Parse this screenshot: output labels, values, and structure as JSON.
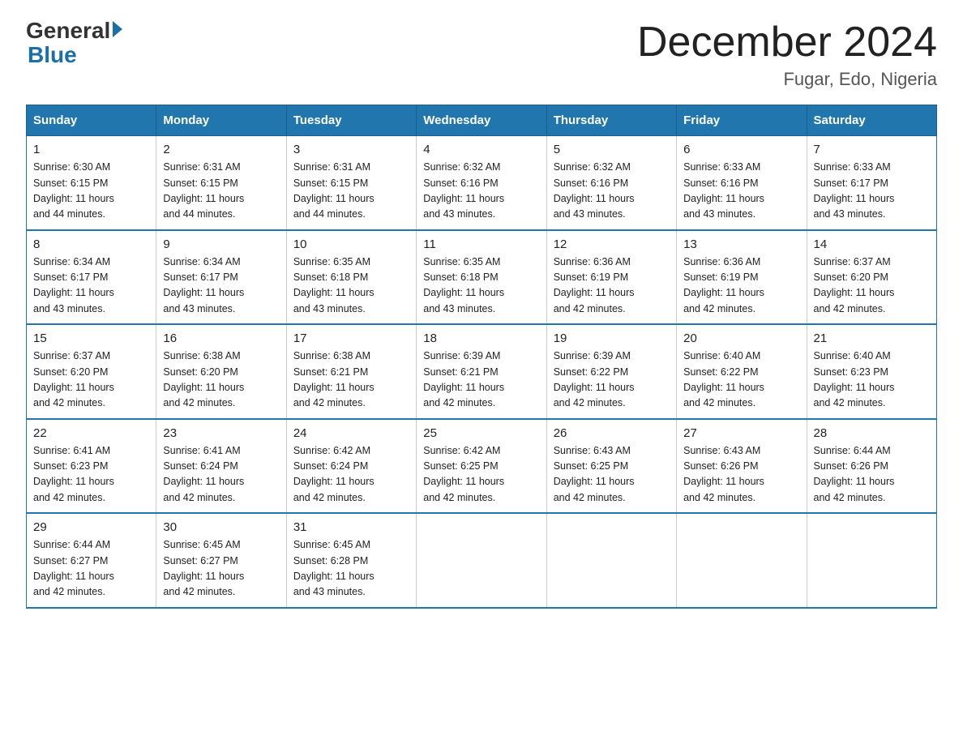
{
  "logo": {
    "general": "General",
    "blue": "Blue"
  },
  "header": {
    "month": "December 2024",
    "location": "Fugar, Edo, Nigeria"
  },
  "days_of_week": [
    "Sunday",
    "Monday",
    "Tuesday",
    "Wednesday",
    "Thursday",
    "Friday",
    "Saturday"
  ],
  "weeks": [
    [
      {
        "day": "1",
        "sunrise": "6:30 AM",
        "sunset": "6:15 PM",
        "daylight": "11 hours and 44 minutes."
      },
      {
        "day": "2",
        "sunrise": "6:31 AM",
        "sunset": "6:15 PM",
        "daylight": "11 hours and 44 minutes."
      },
      {
        "day": "3",
        "sunrise": "6:31 AM",
        "sunset": "6:15 PM",
        "daylight": "11 hours and 44 minutes."
      },
      {
        "day": "4",
        "sunrise": "6:32 AM",
        "sunset": "6:16 PM",
        "daylight": "11 hours and 43 minutes."
      },
      {
        "day": "5",
        "sunrise": "6:32 AM",
        "sunset": "6:16 PM",
        "daylight": "11 hours and 43 minutes."
      },
      {
        "day": "6",
        "sunrise": "6:33 AM",
        "sunset": "6:16 PM",
        "daylight": "11 hours and 43 minutes."
      },
      {
        "day": "7",
        "sunrise": "6:33 AM",
        "sunset": "6:17 PM",
        "daylight": "11 hours and 43 minutes."
      }
    ],
    [
      {
        "day": "8",
        "sunrise": "6:34 AM",
        "sunset": "6:17 PM",
        "daylight": "11 hours and 43 minutes."
      },
      {
        "day": "9",
        "sunrise": "6:34 AM",
        "sunset": "6:17 PM",
        "daylight": "11 hours and 43 minutes."
      },
      {
        "day": "10",
        "sunrise": "6:35 AM",
        "sunset": "6:18 PM",
        "daylight": "11 hours and 43 minutes."
      },
      {
        "day": "11",
        "sunrise": "6:35 AM",
        "sunset": "6:18 PM",
        "daylight": "11 hours and 43 minutes."
      },
      {
        "day": "12",
        "sunrise": "6:36 AM",
        "sunset": "6:19 PM",
        "daylight": "11 hours and 42 minutes."
      },
      {
        "day": "13",
        "sunrise": "6:36 AM",
        "sunset": "6:19 PM",
        "daylight": "11 hours and 42 minutes."
      },
      {
        "day": "14",
        "sunrise": "6:37 AM",
        "sunset": "6:20 PM",
        "daylight": "11 hours and 42 minutes."
      }
    ],
    [
      {
        "day": "15",
        "sunrise": "6:37 AM",
        "sunset": "6:20 PM",
        "daylight": "11 hours and 42 minutes."
      },
      {
        "day": "16",
        "sunrise": "6:38 AM",
        "sunset": "6:20 PM",
        "daylight": "11 hours and 42 minutes."
      },
      {
        "day": "17",
        "sunrise": "6:38 AM",
        "sunset": "6:21 PM",
        "daylight": "11 hours and 42 minutes."
      },
      {
        "day": "18",
        "sunrise": "6:39 AM",
        "sunset": "6:21 PM",
        "daylight": "11 hours and 42 minutes."
      },
      {
        "day": "19",
        "sunrise": "6:39 AM",
        "sunset": "6:22 PM",
        "daylight": "11 hours and 42 minutes."
      },
      {
        "day": "20",
        "sunrise": "6:40 AM",
        "sunset": "6:22 PM",
        "daylight": "11 hours and 42 minutes."
      },
      {
        "day": "21",
        "sunrise": "6:40 AM",
        "sunset": "6:23 PM",
        "daylight": "11 hours and 42 minutes."
      }
    ],
    [
      {
        "day": "22",
        "sunrise": "6:41 AM",
        "sunset": "6:23 PM",
        "daylight": "11 hours and 42 minutes."
      },
      {
        "day": "23",
        "sunrise": "6:41 AM",
        "sunset": "6:24 PM",
        "daylight": "11 hours and 42 minutes."
      },
      {
        "day": "24",
        "sunrise": "6:42 AM",
        "sunset": "6:24 PM",
        "daylight": "11 hours and 42 minutes."
      },
      {
        "day": "25",
        "sunrise": "6:42 AM",
        "sunset": "6:25 PM",
        "daylight": "11 hours and 42 minutes."
      },
      {
        "day": "26",
        "sunrise": "6:43 AM",
        "sunset": "6:25 PM",
        "daylight": "11 hours and 42 minutes."
      },
      {
        "day": "27",
        "sunrise": "6:43 AM",
        "sunset": "6:26 PM",
        "daylight": "11 hours and 42 minutes."
      },
      {
        "day": "28",
        "sunrise": "6:44 AM",
        "sunset": "6:26 PM",
        "daylight": "11 hours and 42 minutes."
      }
    ],
    [
      {
        "day": "29",
        "sunrise": "6:44 AM",
        "sunset": "6:27 PM",
        "daylight": "11 hours and 42 minutes."
      },
      {
        "day": "30",
        "sunrise": "6:45 AM",
        "sunset": "6:27 PM",
        "daylight": "11 hours and 42 minutes."
      },
      {
        "day": "31",
        "sunrise": "6:45 AM",
        "sunset": "6:28 PM",
        "daylight": "11 hours and 43 minutes."
      },
      null,
      null,
      null,
      null
    ]
  ],
  "labels": {
    "sunrise": "Sunrise:",
    "sunset": "Sunset:",
    "daylight": "Daylight:"
  }
}
